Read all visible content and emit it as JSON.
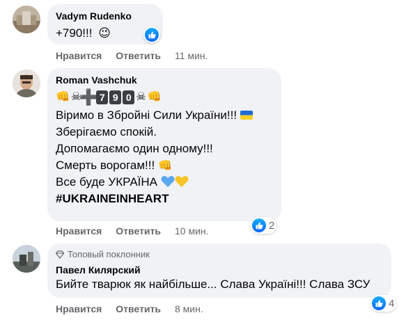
{
  "comments": [
    {
      "author": "Vadym Rudenko",
      "text": "+790!!!",
      "emoji": "😉",
      "like_label": "Нравится",
      "reply_label": "Ответить",
      "time": "11 мин."
    },
    {
      "author": "Roman Vashchuk",
      "emoji_row": {
        "fist": "👊",
        "skull": "☠",
        "plus": "➕",
        "digits": [
          "7",
          "9",
          "0"
        ]
      },
      "lines": [
        "Віримо в Збройні Сили України!!!",
        "Зберігаємо спокій.",
        "Допомагаємо один одному!!!",
        "Смерть ворогам!!!",
        "Все буде УКРАЇНА"
      ],
      "hashtag": "#UKRAINEINHEART",
      "like_label": "Нравится",
      "reply_label": "Ответить",
      "time": "10 мин.",
      "reactions": "2"
    },
    {
      "badge": "Топовый поклонник",
      "author": "Павел Килярский",
      "text": "Бийте тварюк як найбільше... Слава Україні!!! Слава ЗСУ",
      "like_label": "Нравится",
      "reply_label": "Ответить",
      "time": "8 мин.",
      "reactions": "4"
    }
  ],
  "colors": {
    "bubble": "#f0f2f5",
    "meta": "#65676b",
    "like_blue": "#0866ff"
  }
}
